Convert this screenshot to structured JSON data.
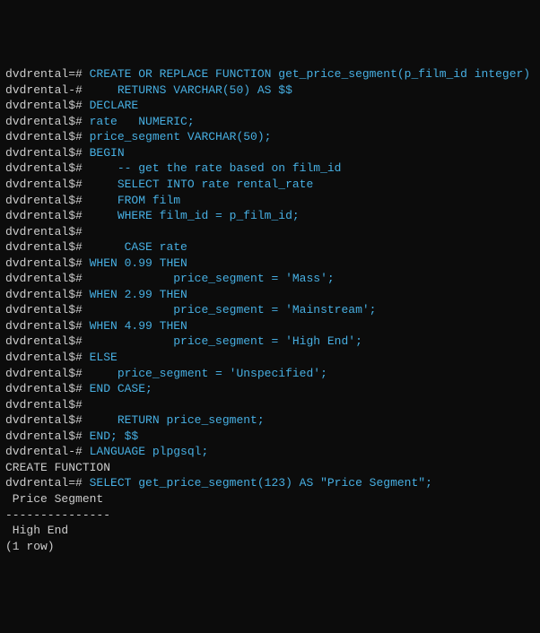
{
  "prompts": {
    "main": "dvdrental=#",
    "cont1": "dvdrental-#",
    "cont2": "dvdrental$#"
  },
  "lines": [
    {
      "p": "main",
      "t": " CREATE OR REPLACE FUNCTION get_price_segment(p_film_id integer)"
    },
    {
      "p": "cont1",
      "t": "     RETURNS VARCHAR(50) AS $$"
    },
    {
      "p": "cont2",
      "t": " DECLARE"
    },
    {
      "p": "cont2",
      "t": " rate   NUMERIC;"
    },
    {
      "p": "cont2",
      "t": " price_segment VARCHAR(50);"
    },
    {
      "p": "cont2",
      "t": " BEGIN"
    },
    {
      "p": "cont2",
      "t": "     -- get the rate based on film_id"
    },
    {
      "p": "cont2",
      "t": "     SELECT INTO rate rental_rate"
    },
    {
      "p": "cont2",
      "t": "     FROM film"
    },
    {
      "p": "cont2",
      "t": "     WHERE film_id = p_film_id;"
    },
    {
      "p": "cont2",
      "t": ""
    },
    {
      "p": "cont2",
      "t": "      CASE rate"
    },
    {
      "p": "cont2",
      "t": " WHEN 0.99 THEN"
    },
    {
      "p": "cont2",
      "t": "             price_segment = 'Mass';"
    },
    {
      "p": "cont2",
      "t": " WHEN 2.99 THEN"
    },
    {
      "p": "cont2",
      "t": "             price_segment = 'Mainstream';"
    },
    {
      "p": "cont2",
      "t": " WHEN 4.99 THEN"
    },
    {
      "p": "cont2",
      "t": "             price_segment = 'High End';"
    },
    {
      "p": "cont2",
      "t": " ELSE"
    },
    {
      "p": "cont2",
      "t": "     price_segment = 'Unspecified';"
    },
    {
      "p": "cont2",
      "t": " END CASE;"
    },
    {
      "p": "cont2",
      "t": ""
    },
    {
      "p": "cont2",
      "t": "     RETURN price_segment;"
    },
    {
      "p": "cont2",
      "t": " END; $$"
    },
    {
      "p": "cont1",
      "t": " LANGUAGE plpgsql;"
    }
  ],
  "output1": "CREATE FUNCTION",
  "query": {
    "p": "main",
    "t": " SELECT get_price_segment(123) AS \"Price Segment\";"
  },
  "result": {
    "header": " Price Segment",
    "sep": "---------------",
    "row": " High End",
    "count": "(1 row)"
  }
}
